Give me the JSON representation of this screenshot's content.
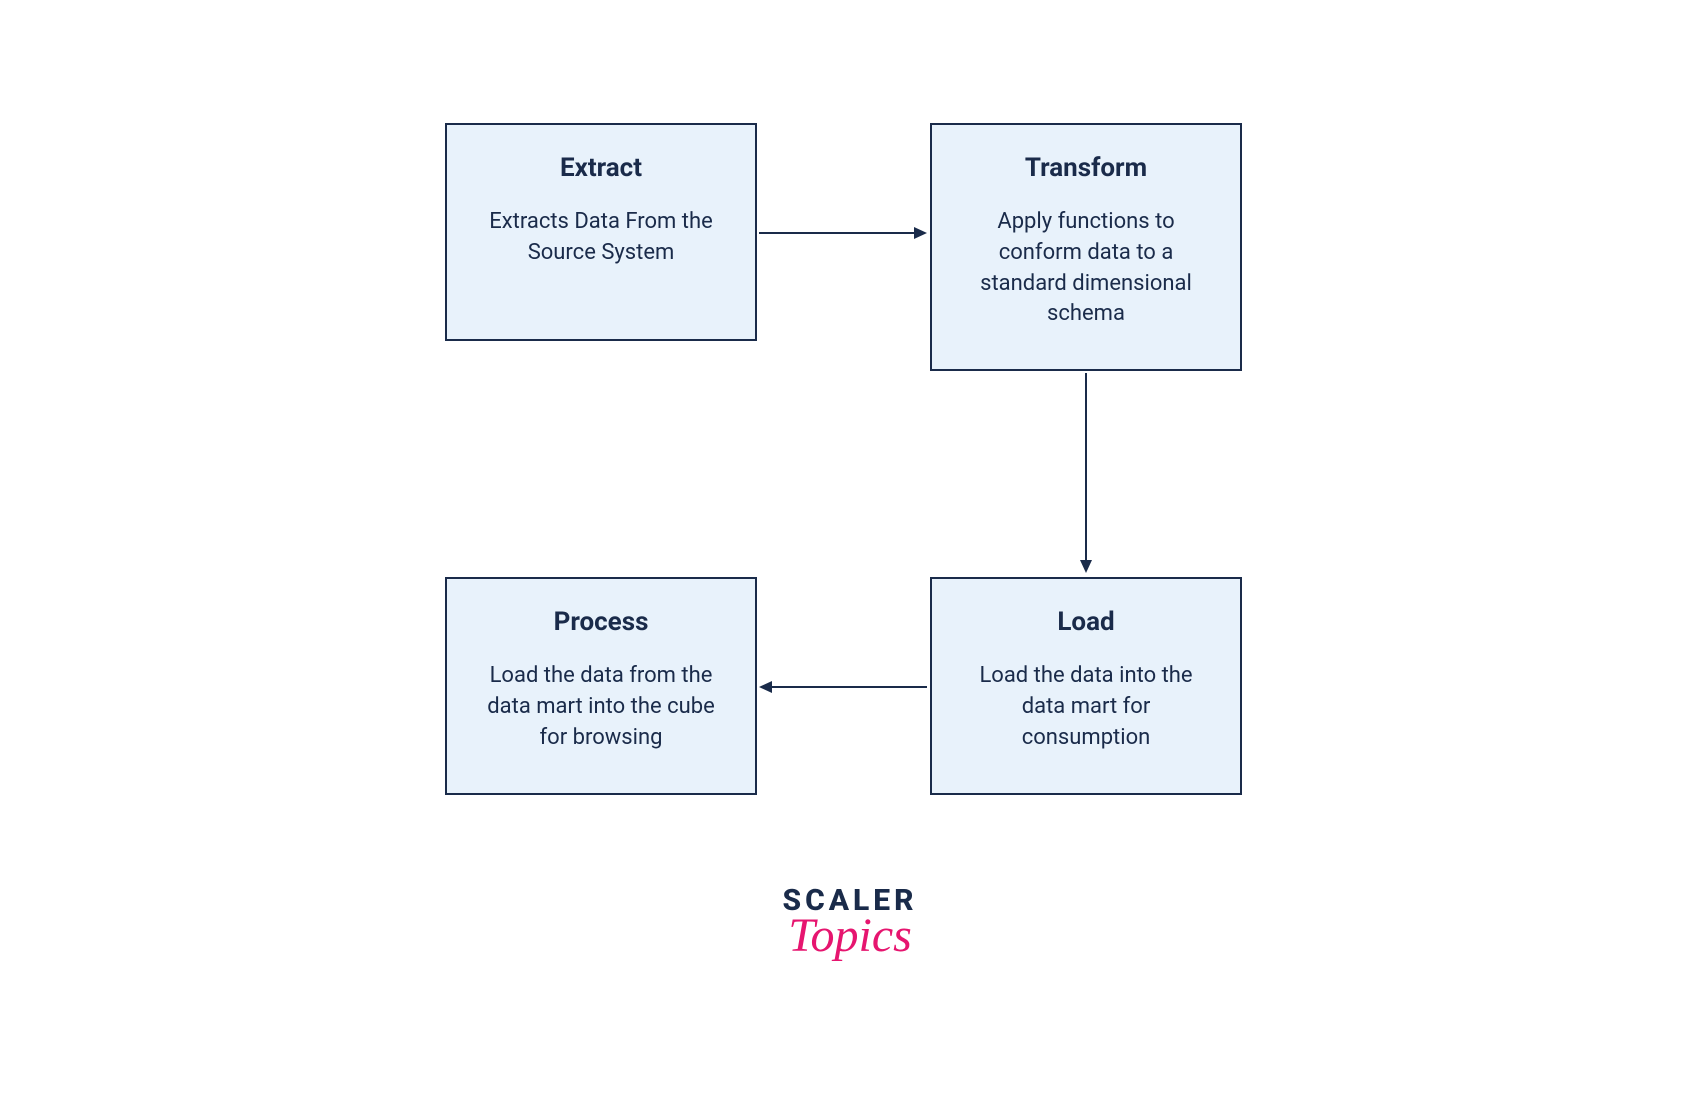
{
  "boxes": {
    "extract": {
      "title": "Extract",
      "desc": "Extracts Data From the Source System"
    },
    "transform": {
      "title": "Transform",
      "desc": "Apply functions to conform data to a standard dimensional schema"
    },
    "load": {
      "title": "Load",
      "desc": "Load the data into the data mart for consumption"
    },
    "process": {
      "title": "Process",
      "desc": "Load the data from the data mart into the cube for browsing"
    }
  },
  "logo": {
    "line1": "SCALER",
    "line2": "Topics"
  },
  "colors": {
    "boxFill": "#e8f2fb",
    "boxBorder": "#1a2b4a",
    "text": "#1a2b4a",
    "accent": "#e6156f"
  }
}
